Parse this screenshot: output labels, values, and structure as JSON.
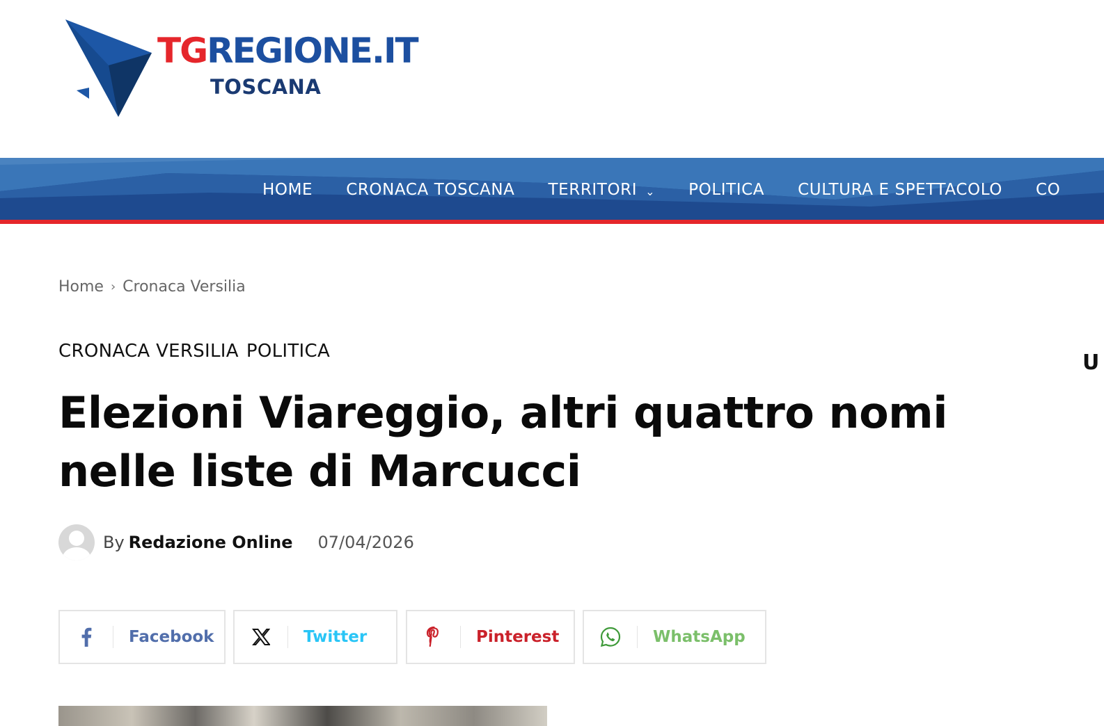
{
  "logo": {
    "brand_tg": "TG",
    "brand_rest": "REGIONE.IT",
    "region": "TOSCANA",
    "colors": {
      "red": "#e5262b",
      "blue": "#1c4fa0",
      "navy": "#1a3a72"
    }
  },
  "nav": {
    "items": [
      {
        "label": "HOME"
      },
      {
        "label": "CRONACA TOSCANA"
      },
      {
        "label": "TERRITORI",
        "dropdown": true
      },
      {
        "label": "POLITICA"
      },
      {
        "label": "CULTURA E SPETTACOLO"
      },
      {
        "label": "CO"
      }
    ],
    "chevron": "⌄",
    "colors": {
      "bar": "#1e4a8f",
      "underline": "#e5262b"
    }
  },
  "breadcrumb": {
    "home": "Home",
    "separator": "›",
    "current": "Cronaca Versilia"
  },
  "categories": [
    "CRONACA VERSILIA",
    "POLITICA"
  ],
  "side_letter": "U",
  "article": {
    "title": "Elezioni Viareggio, altri quattro nomi nelle liste di Marcucci",
    "by": "By",
    "author": "Redazione Online",
    "date": "07/04/2026"
  },
  "share": {
    "facebook": {
      "label": "Facebook",
      "icon": "facebook-icon",
      "color": "#516eab"
    },
    "twitter": {
      "label": "Twitter",
      "icon": "x-icon",
      "color": "#29c5f6"
    },
    "pinterest": {
      "label": "Pinterest",
      "icon": "pinterest-icon",
      "color": "#ca212a"
    },
    "whatsapp": {
      "label": "WhatsApp",
      "icon": "whatsapp-icon",
      "color": "#7bbf6a"
    }
  }
}
